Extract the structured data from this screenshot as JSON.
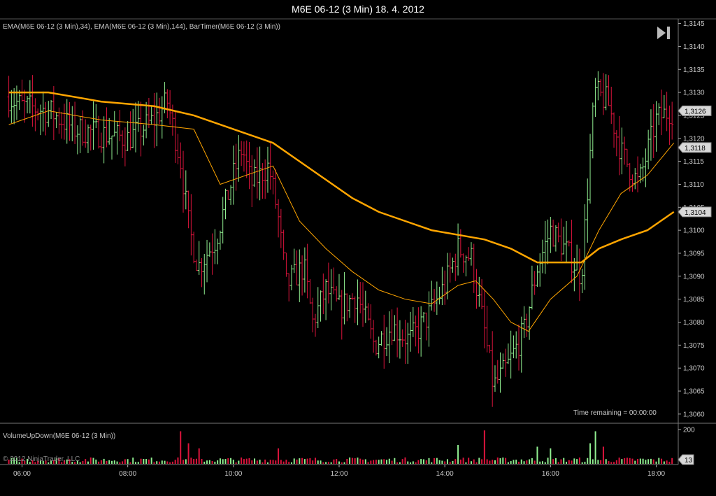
{
  "window": {
    "title": "M6E 06-12 (3 Min)  18. 4. 2012",
    "indicator_label": "EMA(M6E 06-12 (3 Min),34), EMA(M6E 06-12 (3 Min),144), BarTimer(M6E 06-12 (3 Min))",
    "volume_label": "VolumeUpDown(M6E 06-12 (3 Min))",
    "copyright": "© 2012 NinjaTrader, LLC",
    "time_remaining": "Time remaining = 00:00:00",
    "play_icon": "skip-forward-icon"
  },
  "colors": {
    "background": "#000000",
    "up_bar": "#90ee90",
    "down_bar": "#dc143c",
    "ema": "#ffa500",
    "grid": "#3a3a3a",
    "axis_text": "#c8c8c8"
  },
  "chart_data": [
    {
      "type": "ohlc",
      "title": "M6E 06-12 (3 Min)  18. 4. 2012",
      "x_ticks": [
        "06:00",
        "08:00",
        "10:00",
        "12:00",
        "14:00",
        "16:00",
        "18:00"
      ],
      "y_ticks": [
        "1,3060",
        "1,3065",
        "1,3070",
        "1,3075",
        "1,3080",
        "1,3085",
        "1,3090",
        "1,3095",
        "1,3100",
        "1,3105",
        "1,3110",
        "1,3115",
        "1,3120",
        "1,3125",
        "1,3130",
        "1,3135",
        "1,3140",
        "1,3145"
      ],
      "ylim": [
        1.3058,
        1.3146
      ],
      "xlim": [
        "05:35",
        "18:25"
      ],
      "grid": false,
      "price_path": [
        [
          "05:45",
          1.3129
        ],
        [
          "06:00",
          1.3127
        ],
        [
          "06:30",
          1.3126
        ],
        [
          "07:00",
          1.3122
        ],
        [
          "07:30",
          1.3121
        ],
        [
          "08:00",
          1.312
        ],
        [
          "08:30",
          1.3124
        ],
        [
          "08:45",
          1.3128
        ],
        [
          "09:00",
          1.3115
        ],
        [
          "09:10",
          1.31
        ],
        [
          "09:20",
          1.3092
        ],
        [
          "09:40",
          1.3098
        ],
        [
          "10:00",
          1.3112
        ],
        [
          "10:10",
          1.3118
        ],
        [
          "10:20",
          1.311
        ],
        [
          "10:40",
          1.3114
        ],
        [
          "10:50",
          1.3104
        ],
        [
          "11:00",
          1.3088
        ],
        [
          "11:20",
          1.3092
        ],
        [
          "11:30",
          1.308
        ],
        [
          "11:45",
          1.3087
        ],
        [
          "12:00",
          1.3083
        ],
        [
          "12:20",
          1.3086
        ],
        [
          "12:40",
          1.3075
        ],
        [
          "13:00",
          1.3079
        ],
        [
          "13:20",
          1.3076
        ],
        [
          "13:40",
          1.3081
        ],
        [
          "14:00",
          1.3088
        ],
        [
          "14:15",
          1.3096
        ],
        [
          "14:30",
          1.3094
        ],
        [
          "14:45",
          1.3078
        ],
        [
          "14:55",
          1.3066
        ],
        [
          "15:10",
          1.307
        ],
        [
          "15:30",
          1.3078
        ],
        [
          "15:45",
          1.3092
        ],
        [
          "16:00",
          1.31
        ],
        [
          "16:20",
          1.3095
        ],
        [
          "16:35",
          1.309
        ],
        [
          "16:50",
          1.313
        ],
        [
          "17:05",
          1.3128
        ],
        [
          "17:20",
          1.3117
        ],
        [
          "17:40",
          1.311
        ],
        [
          "18:00",
          1.3124
        ],
        [
          "18:15",
          1.3126
        ],
        [
          "18:20",
          1.3126
        ]
      ],
      "series": [
        {
          "name": "EMA(M6E 06-12 (3 Min),34)",
          "points": [
            [
              "05:45",
              1.3123
            ],
            [
              "06:30",
              1.3126
            ],
            [
              "07:30",
              1.3124
            ],
            [
              "08:30",
              1.3123
            ],
            [
              "09:15",
              1.3122
            ],
            [
              "09:45",
              1.311
            ],
            [
              "10:15",
              1.3112
            ],
            [
              "10:45",
              1.3114
            ],
            [
              "11:15",
              1.3102
            ],
            [
              "11:45",
              1.3096
            ],
            [
              "12:15",
              1.3091
            ],
            [
              "12:45",
              1.3087
            ],
            [
              "13:15",
              1.3085
            ],
            [
              "13:45",
              1.3084
            ],
            [
              "14:15",
              1.3088
            ],
            [
              "14:35",
              1.3089
            ],
            [
              "14:55",
              1.3085
            ],
            [
              "15:15",
              1.308
            ],
            [
              "15:35",
              1.3078
            ],
            [
              "16:00",
              1.3085
            ],
            [
              "16:30",
              1.309
            ],
            [
              "16:55",
              1.31
            ],
            [
              "17:20",
              1.3108
            ],
            [
              "17:50",
              1.3112
            ],
            [
              "18:20",
              1.3119
            ]
          ]
        },
        {
          "name": "EMA(M6E 06-12 (3 Min),144)",
          "points": [
            [
              "05:45",
              1.313
            ],
            [
              "06:30",
              1.313
            ],
            [
              "07:30",
              1.3128
            ],
            [
              "08:30",
              1.3127
            ],
            [
              "09:15",
              1.3125
            ],
            [
              "09:45",
              1.3123
            ],
            [
              "10:15",
              1.3121
            ],
            [
              "10:45",
              1.3119
            ],
            [
              "11:15",
              1.3115
            ],
            [
              "11:45",
              1.3111
            ],
            [
              "12:15",
              1.3107
            ],
            [
              "12:45",
              1.3104
            ],
            [
              "13:15",
              1.3102
            ],
            [
              "13:45",
              1.31
            ],
            [
              "14:15",
              1.3099
            ],
            [
              "14:45",
              1.3098
            ],
            [
              "15:15",
              1.3096
            ],
            [
              "15:45",
              1.3093
            ],
            [
              "16:15",
              1.3093
            ],
            [
              "16:35",
              1.3093
            ],
            [
              "16:55",
              1.3096
            ],
            [
              "17:20",
              1.3098
            ],
            [
              "17:50",
              1.31
            ],
            [
              "18:20",
              1.3104
            ]
          ]
        }
      ],
      "price_markers": [
        {
          "label": "1,3126",
          "value": 1.3126
        },
        {
          "label": "1,3118",
          "value": 1.3118
        },
        {
          "label": "1,3104",
          "value": 1.3104
        }
      ]
    },
    {
      "type": "bar",
      "title": "VolumeUpDown(M6E 06-12 (3 Min))",
      "y_ticks": [
        "200"
      ],
      "ylim": [
        0,
        200
      ],
      "last_value_label": "13",
      "spikes": [
        [
          "09:00",
          190,
          "down"
        ],
        [
          "09:10",
          120,
          "down"
        ],
        [
          "09:20",
          90,
          "down"
        ],
        [
          "10:50",
          90,
          "down"
        ],
        [
          "14:15",
          110,
          "up"
        ],
        [
          "14:45",
          195,
          "down"
        ],
        [
          "15:45",
          100,
          "up"
        ],
        [
          "16:00",
          90,
          "up"
        ],
        [
          "16:50",
          190,
          "up"
        ],
        [
          "16:45",
          120,
          "up"
        ],
        [
          "17:00",
          100,
          "down"
        ]
      ]
    }
  ]
}
